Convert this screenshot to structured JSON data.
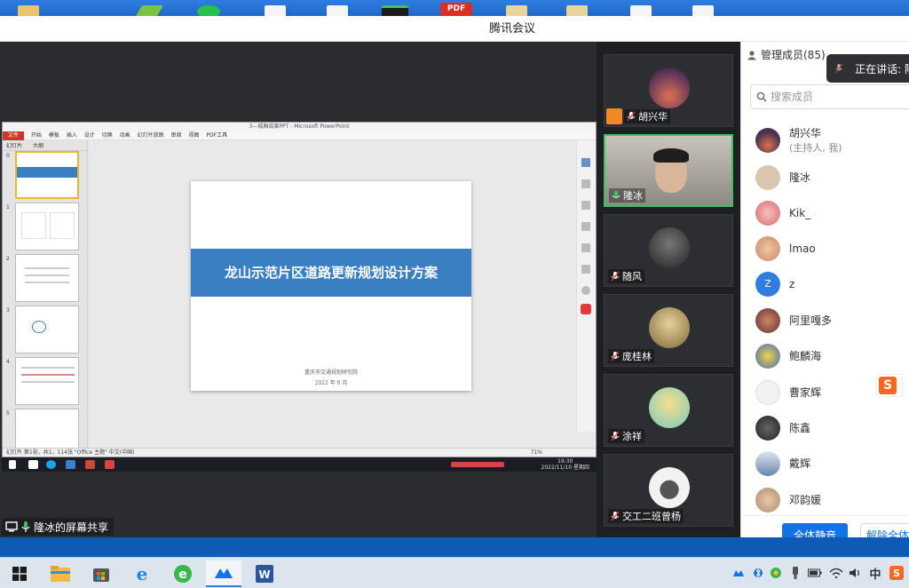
{
  "window": {
    "title": "腾讯会议"
  },
  "ppt": {
    "window_title": "3—城厢成果PPT - Microsoft PowerPoint",
    "file_tab": "文件",
    "tabs": [
      "开始",
      "模板",
      "插入",
      "设计",
      "切换",
      "动画",
      "幻灯片放映",
      "审阅",
      "视图",
      "PDF工具"
    ],
    "pane_tabs": [
      "幻灯片",
      "大纲"
    ],
    "slide_title": "龙山示范片区道路更新规划设计方案",
    "slide_org": "重庆市交通规划研究院",
    "slide_date": "2022 年 8 月",
    "status_text": "幻灯片 第1张，共1，114张    \"Office 主题\"    中文(中国)",
    "zoom": "71%",
    "clock_time": "19:30",
    "clock_date": "2022/11/10 星期四",
    "thumb_numbers": [
      "0",
      "1",
      "2",
      "3",
      "4",
      "5"
    ]
  },
  "share": {
    "label": "隆冰的屏幕共享"
  },
  "videos": [
    {
      "name": "胡兴华",
      "color": "#6b3b5a",
      "muted": true
    },
    {
      "name": "隆冰",
      "color": "#8a7a66",
      "muted": false,
      "active": true
    },
    {
      "name": "随风",
      "color": "#3a3a3a",
      "muted": true
    },
    {
      "name": "庞桂林",
      "color": "#b59a5a",
      "muted": true
    },
    {
      "name": "涂祥",
      "color": "#9ad0c9",
      "muted": true
    },
    {
      "name": "交工二班曾杨",
      "color": "#e8e8e8",
      "muted": true
    }
  ],
  "members": {
    "header": "管理成员(85)",
    "speaking": "正在讲话: 隆",
    "search_placeholder": "搜索成员",
    "list": [
      {
        "name": "胡兴华",
        "sub": "(主持人, 我)",
        "color": "#4a3550"
      },
      {
        "name": "隆冰",
        "sub": "",
        "color": "#d9c7b0"
      },
      {
        "name": "Kik_",
        "sub": "",
        "color": "#d86a6a"
      },
      {
        "name": "lmao",
        "sub": "",
        "color": "#c9876a"
      },
      {
        "name": "z",
        "sub": "",
        "color": "#2f7de0",
        "letter": "Z"
      },
      {
        "name": "阿里嘎多",
        "sub": "",
        "color": "#6a2f2f"
      },
      {
        "name": "鲍麟海",
        "sub": "",
        "color": "#3b6fb5"
      },
      {
        "name": "曹家辉",
        "sub": "",
        "color": "#f2f2f2"
      },
      {
        "name": "陈鑫",
        "sub": "",
        "color": "#333333"
      },
      {
        "name": "戴辉",
        "sub": "",
        "color": "#9aaac0"
      },
      {
        "name": "邓韵媛",
        "sub": "",
        "color": "#b08a70"
      }
    ],
    "mute_all": "全体静音",
    "unmute_all": "解除全体静音"
  }
}
